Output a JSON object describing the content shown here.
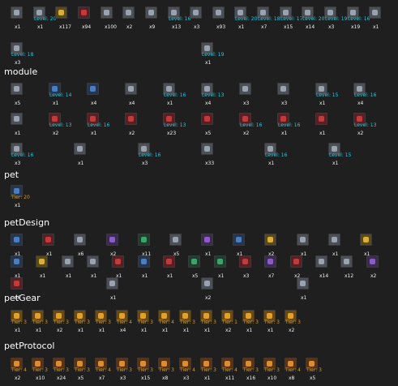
{
  "sections": {
    "top": [
      {
        "level": "",
        "qty": "x1",
        "tone": "metal"
      },
      {
        "level": "Level: 20",
        "qty": "x1",
        "tone": "metal"
      },
      {
        "level": "",
        "qty": "x117",
        "tone": "gold"
      },
      {
        "level": "",
        "qty": "x94",
        "tone": "red"
      },
      {
        "level": "",
        "qty": "x100",
        "tone": "metal"
      },
      {
        "level": "",
        "qty": "x2",
        "tone": "metal"
      },
      {
        "level": "",
        "qty": "x9",
        "tone": "metal"
      },
      {
        "level": "Level: 16",
        "qty": "x13",
        "tone": "metal"
      },
      {
        "level": "",
        "qty": "x3",
        "tone": "metal"
      },
      {
        "level": "",
        "qty": "x93",
        "tone": "metal"
      },
      {
        "level": "Level: 20",
        "qty": "x1",
        "tone": "metal"
      },
      {
        "level": "Level: 18",
        "qty": "x7",
        "tone": "metal"
      },
      {
        "level": "Level: 17",
        "qty": "x15",
        "tone": "metal"
      },
      {
        "level": "Level: 20",
        "qty": "x14",
        "tone": "metal"
      },
      {
        "level": "Level: 19",
        "qty": "x3",
        "tone": "metal"
      },
      {
        "level": "Level: 16",
        "qty": "x19",
        "tone": "metal"
      },
      {
        "level": "",
        "qty": "x1",
        "tone": "metal"
      },
      {
        "level": "Level: 18",
        "qty": "x3",
        "tone": "metal"
      },
      {
        "level": "Level: 19",
        "qty": "x1",
        "tone": "metal"
      }
    ],
    "module": {
      "title": "module",
      "items": [
        {
          "level": "",
          "qty": "x5",
          "tone": "metal"
        },
        {
          "level": "Level: 14",
          "qty": "x1",
          "tone": "blue"
        },
        {
          "level": "",
          "qty": "x4",
          "tone": "blue"
        },
        {
          "level": "",
          "qty": "x4",
          "tone": "metal"
        },
        {
          "level": "Level: 16",
          "qty": "x1",
          "tone": "metal"
        },
        {
          "level": "Level: 13",
          "qty": "x4",
          "tone": "metal"
        },
        {
          "level": "",
          "qty": "x3",
          "tone": "metal"
        },
        {
          "level": "",
          "qty": "x3",
          "tone": "metal"
        },
        {
          "level": "Level: 15",
          "qty": "x1",
          "tone": "metal"
        },
        {
          "level": "Level: 16",
          "qty": "x4",
          "tone": "metal"
        },
        {
          "level": "",
          "qty": "x1",
          "tone": "metal"
        },
        {
          "level": "Level: 13",
          "qty": "x2",
          "tone": "red"
        },
        {
          "level": "Level: 16",
          "qty": "x1",
          "tone": "red"
        },
        {
          "level": "",
          "qty": "x2",
          "tone": "red"
        },
        {
          "level": "Level: 13",
          "qty": "x23",
          "tone": "red"
        },
        {
          "level": "",
          "qty": "x5",
          "tone": "red"
        },
        {
          "level": "Level: 16",
          "qty": "x2",
          "tone": "red"
        },
        {
          "level": "Level: 16",
          "qty": "x1",
          "tone": "red"
        },
        {
          "level": "",
          "qty": "x1",
          "tone": "red"
        },
        {
          "level": "Level: 13",
          "qty": "x2",
          "tone": "red"
        },
        {
          "level": "Level: 16",
          "qty": "x3",
          "tone": "metal"
        },
        {
          "level": "",
          "qty": "x1",
          "tone": "metal"
        },
        {
          "level": "Level: 16",
          "qty": "x3",
          "tone": "metal"
        },
        {
          "level": "",
          "qty": "x33",
          "tone": "metal"
        },
        {
          "level": "Level: 16",
          "qty": "x1",
          "tone": "metal"
        },
        {
          "level": "Level: 15",
          "qty": "x1",
          "tone": "metal"
        }
      ]
    },
    "pet": {
      "title": "pet",
      "items": [
        {
          "level": "Tier: 20",
          "qty": "x1",
          "tone": "blue"
        }
      ]
    },
    "petDesign": {
      "title": "petDesign",
      "items": [
        {
          "level": "",
          "qty": "x1",
          "tone": "blue"
        },
        {
          "level": "",
          "qty": "x1",
          "tone": "red"
        },
        {
          "level": "",
          "qty": "x6",
          "tone": "metal"
        },
        {
          "level": "",
          "qty": "x2",
          "tone": "purple"
        },
        {
          "level": "",
          "qty": "x11",
          "tone": "green"
        },
        {
          "level": "",
          "qty": "x5",
          "tone": "metal"
        },
        {
          "level": "",
          "qty": "x1",
          "tone": "purple"
        },
        {
          "level": "",
          "qty": "x1",
          "tone": "blue"
        },
        {
          "level": "",
          "qty": "x2",
          "tone": "gold"
        },
        {
          "level": "",
          "qty": "x1",
          "tone": "metal"
        },
        {
          "level": "",
          "qty": "x1",
          "tone": "metal"
        },
        {
          "level": "",
          "qty": "x1",
          "tone": "gold"
        },
        {
          "level": "",
          "qty": "x1",
          "tone": "blue"
        },
        {
          "level": "",
          "qty": "x1",
          "tone": "gold"
        },
        {
          "level": "",
          "qty": "x1",
          "tone": "metal"
        },
        {
          "level": "",
          "qty": "x1",
          "tone": "metal"
        },
        {
          "level": "",
          "qty": "x1",
          "tone": "red"
        },
        {
          "level": "",
          "qty": "x1",
          "tone": "blue"
        },
        {
          "level": "",
          "qty": "x1",
          "tone": "red"
        },
        {
          "level": "",
          "qty": "x5",
          "tone": "green"
        },
        {
          "level": "",
          "qty": "x1",
          "tone": "green"
        },
        {
          "level": "",
          "qty": "x3",
          "tone": "red"
        },
        {
          "level": "",
          "qty": "x7",
          "tone": "purple"
        },
        {
          "level": "",
          "qty": "x2",
          "tone": "red"
        },
        {
          "level": "",
          "qty": "x14",
          "tone": "metal"
        },
        {
          "level": "",
          "qty": "x12",
          "tone": "metal"
        },
        {
          "level": "",
          "qty": "x2",
          "tone": "purple"
        },
        {
          "level": "",
          "qty": "x6",
          "tone": "red"
        },
        {
          "level": "",
          "qty": "x1",
          "tone": "metal"
        },
        {
          "level": "",
          "qty": "x2",
          "tone": "metal"
        },
        {
          "level": "",
          "qty": "x1",
          "tone": "metal"
        }
      ]
    },
    "petGear": {
      "title": "petGear",
      "items": [
        {
          "level": "Tier: 3",
          "qty": "x1",
          "tone": "gear"
        },
        {
          "level": "Tier: 3",
          "qty": "x1",
          "tone": "gear"
        },
        {
          "level": "Tier: 3",
          "qty": "x2",
          "tone": "gear"
        },
        {
          "level": "Tier: 3",
          "qty": "x1",
          "tone": "gear"
        },
        {
          "level": "Tier: 3",
          "qty": "x1",
          "tone": "gear"
        },
        {
          "level": "Tier: 4",
          "qty": "x4",
          "tone": "gear"
        },
        {
          "level": "Tier: 3",
          "qty": "x1",
          "tone": "gear"
        },
        {
          "level": "Tier: 4",
          "qty": "x1",
          "tone": "gear"
        },
        {
          "level": "Tier: 3",
          "qty": "x1",
          "tone": "gear"
        },
        {
          "level": "Tier: 3",
          "qty": "x1",
          "tone": "gear"
        },
        {
          "level": "Tier: 1",
          "qty": "x2",
          "tone": "gear"
        },
        {
          "level": "Tier: 3",
          "qty": "x1",
          "tone": "gear"
        },
        {
          "level": "Tier: 3",
          "qty": "x1",
          "tone": "gear"
        },
        {
          "level": "Tier: 3",
          "qty": "x2",
          "tone": "gear"
        }
      ]
    },
    "petProtocol": {
      "title": "petProtocol",
      "items": [
        {
          "level": "Tier: 4",
          "qty": "x2",
          "tone": "proto"
        },
        {
          "level": "Tier: 3",
          "qty": "x10",
          "tone": "proto"
        },
        {
          "level": "Tier: 3",
          "qty": "x24",
          "tone": "proto"
        },
        {
          "level": "Tier: 3",
          "qty": "x5",
          "tone": "proto"
        },
        {
          "level": "Tier: 4",
          "qty": "x7",
          "tone": "proto"
        },
        {
          "level": "Tier: 3",
          "qty": "x3",
          "tone": "proto"
        },
        {
          "level": "Tier: 3",
          "qty": "x15",
          "tone": "proto"
        },
        {
          "level": "Tier: 3",
          "qty": "x8",
          "tone": "proto"
        },
        {
          "level": "Tier: 4",
          "qty": "x3",
          "tone": "proto"
        },
        {
          "level": "Tier: 3",
          "qty": "x1",
          "tone": "proto"
        },
        {
          "level": "Tier: 4",
          "qty": "x11",
          "tone": "proto"
        },
        {
          "level": "Tier: 3",
          "qty": "x16",
          "tone": "proto"
        },
        {
          "level": "Tier: 3",
          "qty": "x10",
          "tone": "proto"
        },
        {
          "level": "Tier: 4",
          "qty": "x8",
          "tone": "proto"
        },
        {
          "level": "Tier: 3",
          "qty": "x5",
          "tone": "proto"
        }
      ]
    }
  },
  "colors": {
    "background": "#1f1f1f",
    "levelCyan": "#31c6dc",
    "tierOrange": "#d89a1e",
    "heading": "#ffffff"
  }
}
